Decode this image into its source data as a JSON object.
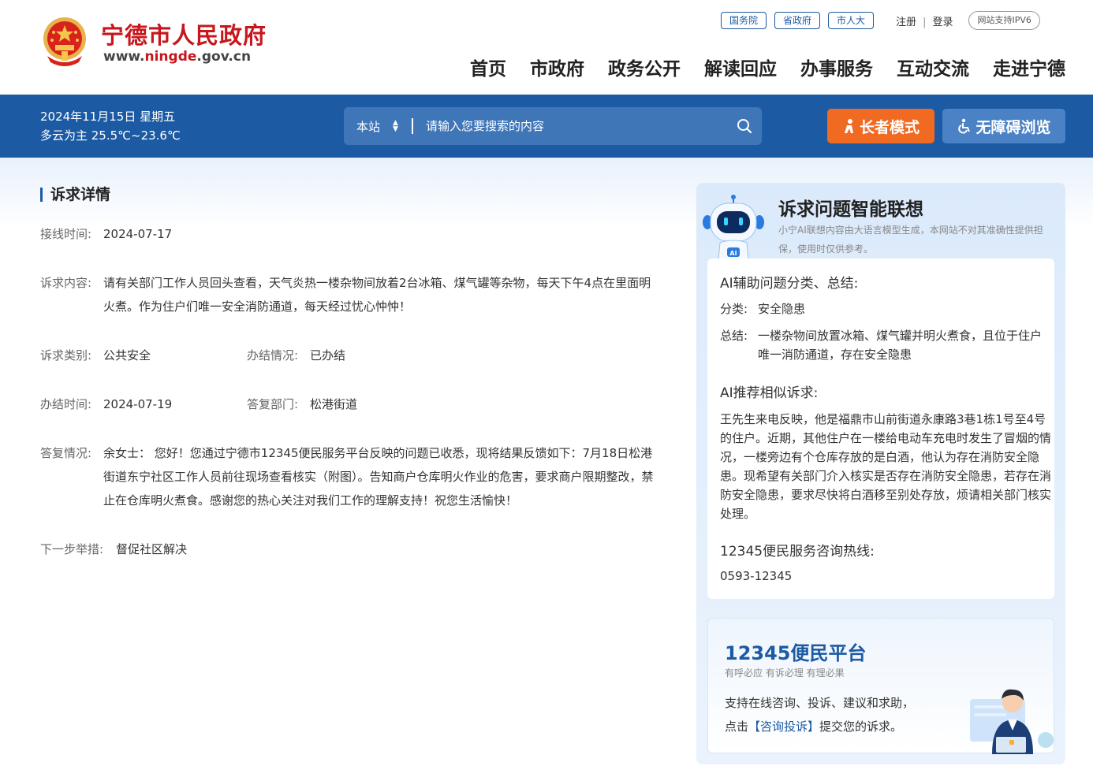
{
  "header": {
    "site_title": "宁德市人民政府",
    "url_prefix": "www.",
    "url_highlight": "ningde",
    "url_suffix": ".gov.cn",
    "top_links": [
      "国务院",
      "省政府",
      "市人大"
    ],
    "register": "注册",
    "separator": "|",
    "login": "登录",
    "ipv6": "网站支持IPV6",
    "nav": [
      "首页",
      "市政府",
      "政务公开",
      "解读回应",
      "办事服务",
      "互动交流",
      "走进宁德"
    ]
  },
  "toolbar": {
    "date": "2024年11月15日 星期五",
    "weather": "多云为主  25.5℃~23.6℃",
    "search_scope": "本站",
    "search_placeholder": "请输入您要搜索的内容",
    "elder_mode": "长者模式",
    "accessible": "无障碍浏览"
  },
  "detail": {
    "title": "诉求详情",
    "received_label": "接线时间:",
    "received_value": "2024-07-17",
    "content_label": "诉求内容:",
    "content_value": "请有关部门工作人员回头查看，天气炎热一楼杂物间放着2台冰箱、煤气罐等杂物，每天下午4点在里面明火煮。作为住户们唯一安全消防通道，每天经过忧心忡忡！",
    "category_label": "诉求类别:",
    "category_value": "公共安全",
    "status_label": "办结情况:",
    "status_value": "已办结",
    "closed_label": "办结时间:",
    "closed_value": "2024-07-19",
    "dept_label": "答复部门:",
    "dept_value": "松港街道",
    "reply_label": "答复情况:",
    "reply_value": "余女士： 您好！您通过宁德市12345便民服务平台反映的问题已收悉，现将结果反馈如下：7月18日松港街道东宁社区工作人员前往现场查看核实（附图）。告知商户仓库明火作业的危害，要求商户限期整改，禁止在仓库明火煮食。感谢您的热心关注对我们工作的理解支持！祝您生活愉快！",
    "next_label": "下一步举措:",
    "next_value": "督促社区解决"
  },
  "ai": {
    "title": "诉求问题智能联想",
    "note": "小宁AI联想内容由大语言模型生成，本网站不对其准确性提供担保，使用时仅供参考。",
    "classify_heading": "AI辅助问题分类、总结:",
    "category_label": "分类:",
    "category_value": "安全隐患",
    "summary_label": "总结:",
    "summary_value": "一楼杂物间放置冰箱、煤气罐并明火煮食，且位于住户唯一消防通道，存在安全隐患",
    "similar_heading": "AI推荐相似诉求:",
    "similar_text": "王先生来电反映，他是福鼎市山前街道永康路3巷1栋1号至4号的住户。近期，其他住户在一楼给电动车充电时发生了冒烟的情况，一楼旁边有个仓库存放的是白酒，他认为存在消防安全隐患。现希望有关部门介入核实是否存在消防安全隐患，若存在消防安全隐患，要求尽快将白酒移至别处存放，烦请相关部门核实处理。",
    "hotline_heading": "12345便民服务咨询热线:",
    "hotline": "0593-12345",
    "robot_badge": "AI"
  },
  "platform": {
    "title": "12345便民平台",
    "slogan": "有呼必应 有诉必理 有理必果",
    "desc_line1": "支持在线咨询、投诉、建议和求助，",
    "desc_pre": "点击",
    "desc_link": "【咨询投诉】",
    "desc_post": "提交您的诉求。"
  },
  "colors": {
    "brand_red": "#c8161d",
    "brand_blue": "#1c5aa3",
    "elder_orange": "#f06a22"
  }
}
